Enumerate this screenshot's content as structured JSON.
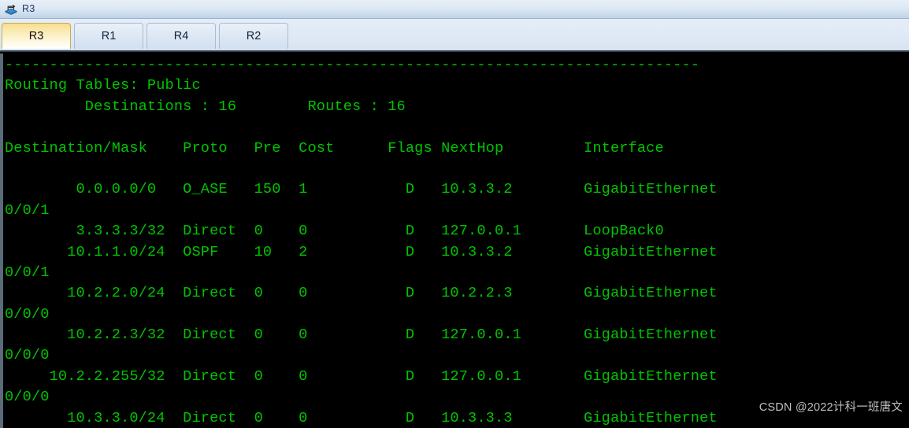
{
  "window": {
    "title": "R3",
    "icon": "router-device-icon"
  },
  "tabs": {
    "active_index": 0,
    "items": [
      {
        "label": "R3"
      },
      {
        "label": "R1"
      },
      {
        "label": "R4"
      },
      {
        "label": "R2"
      }
    ]
  },
  "terminal": {
    "colors": {
      "background": "#000000",
      "text": "#00c400",
      "watermark": "#e4e8ec"
    },
    "lines": [
      "------------------------------------------------------------------------------",
      "Routing Tables: Public",
      "         Destinations : 16        Routes : 16",
      "",
      "Destination/Mask    Proto   Pre  Cost      Flags NextHop         Interface",
      "",
      "        0.0.0.0/0   O_ASE   150  1           D   10.3.3.2        GigabitEthernet",
      "0/0/1",
      "        3.3.3.3/32  Direct  0    0           D   127.0.0.1       LoopBack0",
      "       10.1.1.0/24  OSPF    10   2           D   10.3.3.2        GigabitEthernet",
      "0/0/1",
      "       10.2.2.0/24  Direct  0    0           D   10.2.2.3        GigabitEthernet",
      "0/0/0",
      "       10.2.2.3/32  Direct  0    0           D   127.0.0.1       GigabitEthernet",
      "0/0/0",
      "     10.2.2.255/32  Direct  0    0           D   127.0.0.1       GigabitEthernet",
      "0/0/0",
      "       10.3.3.0/24  Direct  0    0           D   10.3.3.3        GigabitEthernet"
    ],
    "routing_table": {
      "name": "Public",
      "destinations": "16",
      "routes": "16",
      "columns": [
        "Destination/Mask",
        "Proto",
        "Pre",
        "Cost",
        "Flags",
        "NextHop",
        "Interface"
      ],
      "rows": [
        {
          "destination": "0.0.0.0/0",
          "proto": "O_ASE",
          "pre": "150",
          "cost": "1",
          "flags": "D",
          "nexthop": "10.3.3.2",
          "interface": "GigabitEthernet0/0/1"
        },
        {
          "destination": "3.3.3.3/32",
          "proto": "Direct",
          "pre": "0",
          "cost": "0",
          "flags": "D",
          "nexthop": "127.0.0.1",
          "interface": "LoopBack0"
        },
        {
          "destination": "10.1.1.0/24",
          "proto": "OSPF",
          "pre": "10",
          "cost": "2",
          "flags": "D",
          "nexthop": "10.3.3.2",
          "interface": "GigabitEthernet0/0/1"
        },
        {
          "destination": "10.2.2.0/24",
          "proto": "Direct",
          "pre": "0",
          "cost": "0",
          "flags": "D",
          "nexthop": "10.2.2.3",
          "interface": "GigabitEthernet0/0/0"
        },
        {
          "destination": "10.2.2.3/32",
          "proto": "Direct",
          "pre": "0",
          "cost": "0",
          "flags": "D",
          "nexthop": "127.0.0.1",
          "interface": "GigabitEthernet0/0/0"
        },
        {
          "destination": "10.2.2.255/32",
          "proto": "Direct",
          "pre": "0",
          "cost": "0",
          "flags": "D",
          "nexthop": "127.0.0.1",
          "interface": "GigabitEthernet0/0/0"
        },
        {
          "destination": "10.3.3.0/24",
          "proto": "Direct",
          "pre": "0",
          "cost": "0",
          "flags": "D",
          "nexthop": "10.3.3.3",
          "interface": "GigabitEthernet"
        }
      ]
    }
  },
  "watermark": {
    "text": "CSDN @2022计科一班唐文"
  }
}
